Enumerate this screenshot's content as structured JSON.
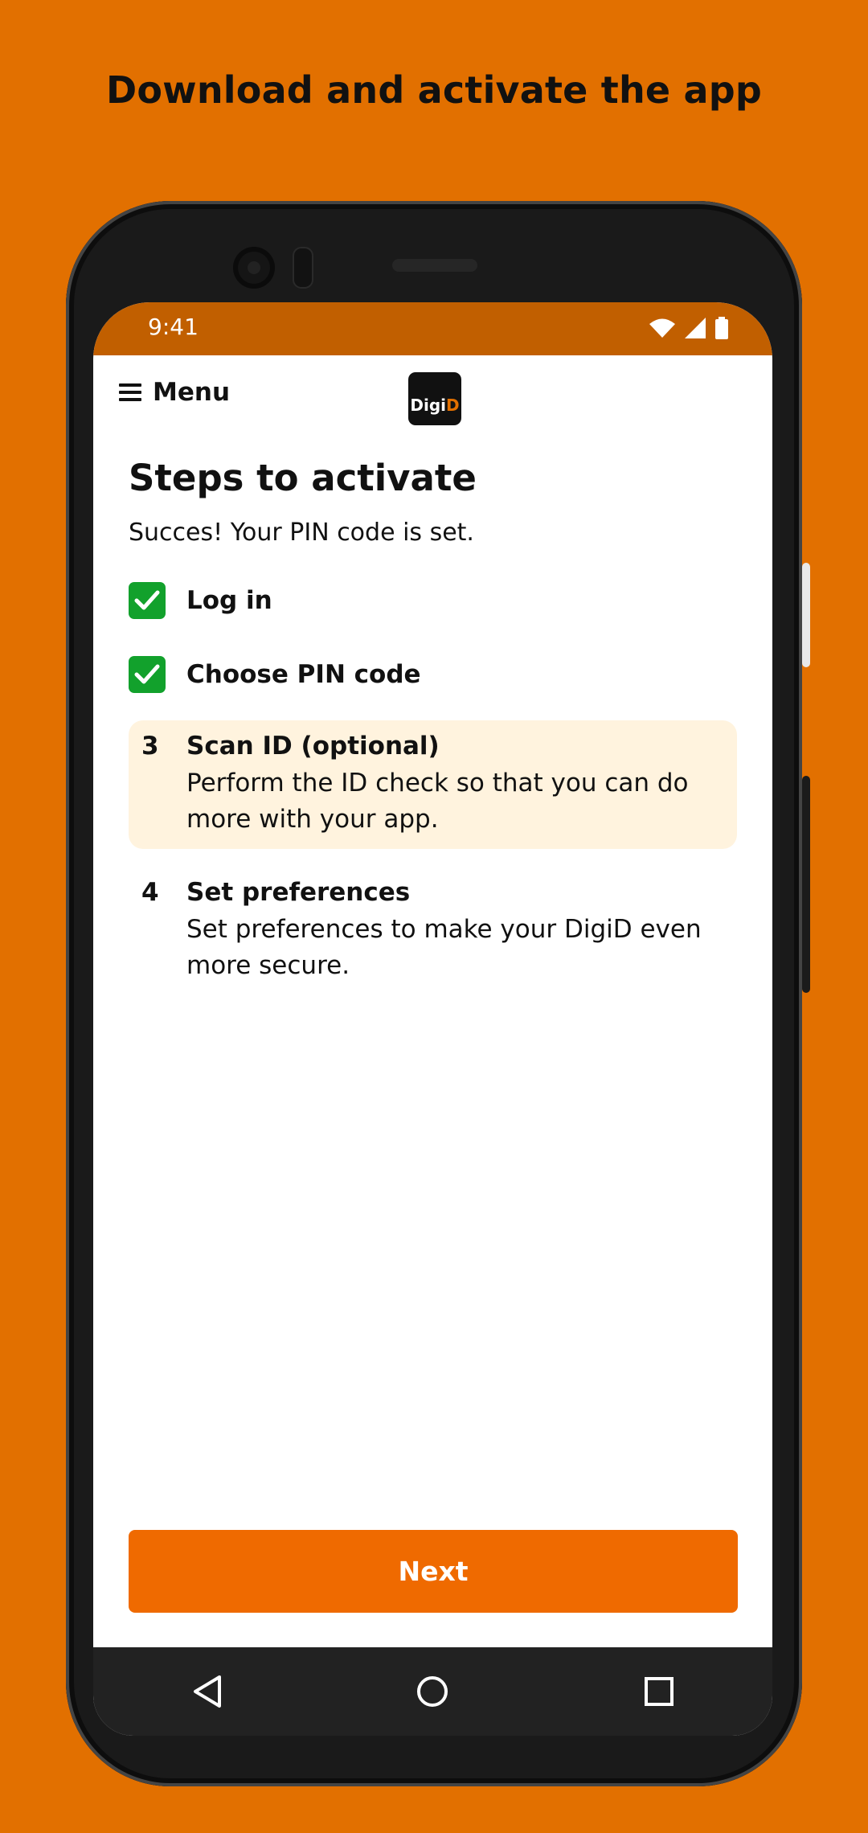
{
  "headline": "Download and activate the app",
  "status": {
    "time": "9:41"
  },
  "appbar": {
    "menu_label": "Menu",
    "logo_text": "Digi",
    "logo_accent": "D"
  },
  "page": {
    "title": "Steps to activate",
    "subtitle": "Succes! Your PIN code is set."
  },
  "steps": [
    {
      "label": "Log in",
      "state": "done"
    },
    {
      "label": "Choose PIN code",
      "state": "done"
    },
    {
      "number": "3",
      "title": "Scan ID (optional)",
      "description": "Perform the ID check so that you can do more with your app.",
      "state": "active"
    },
    {
      "number": "4",
      "title": "Set preferences",
      "description": "Set preferences to make your DigiD even more secure.",
      "state": "pending"
    }
  ],
  "actions": {
    "next_label": "Next"
  },
  "colors": {
    "background": "#e27000",
    "accent": "#ef6a00",
    "check": "#12a12c",
    "active_step_bg": "#fff3de",
    "statusbar": "#c15f00"
  },
  "icons": [
    "menu-icon",
    "wifi-icon",
    "signal-icon",
    "battery-icon",
    "check-icon",
    "back-icon",
    "home-icon",
    "recents-icon"
  ]
}
